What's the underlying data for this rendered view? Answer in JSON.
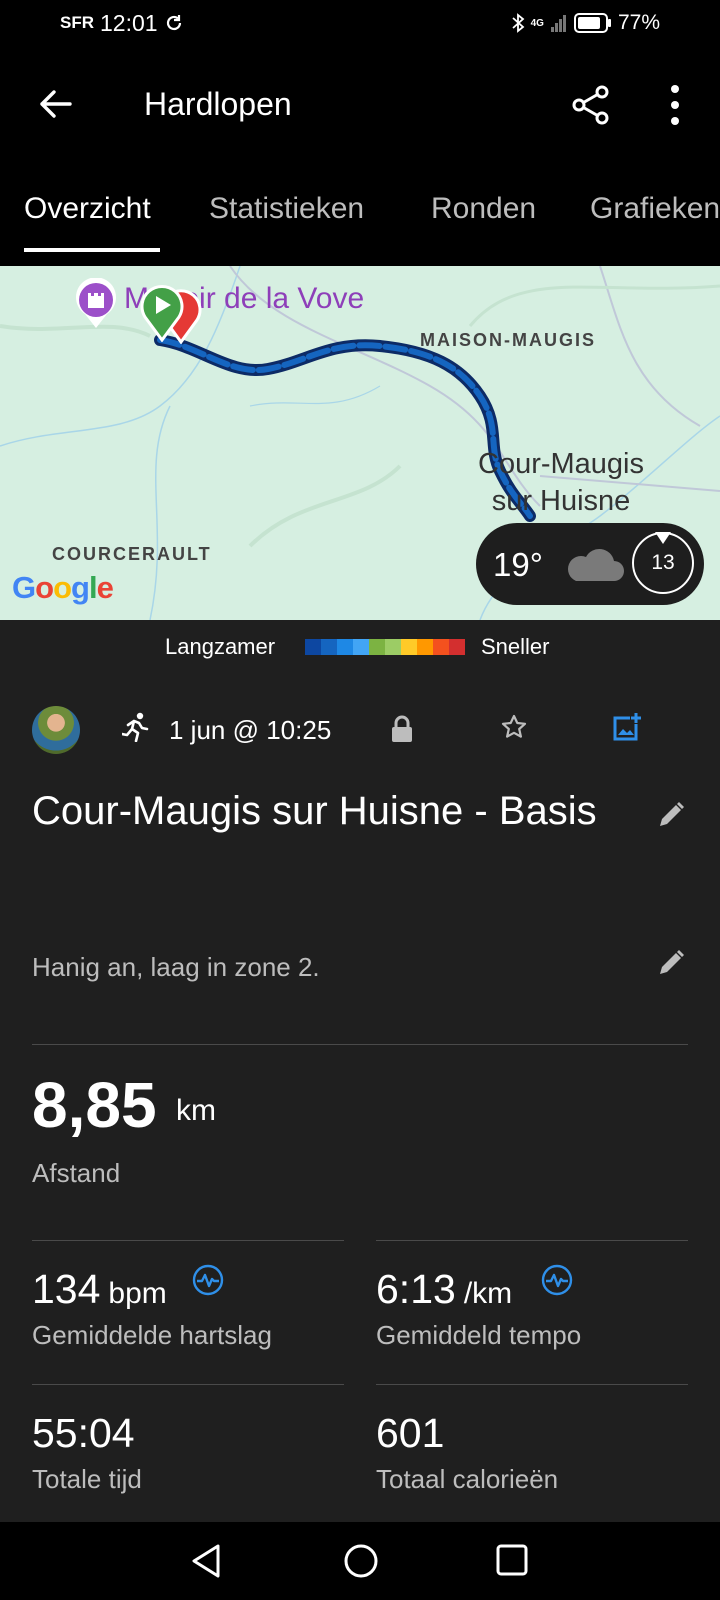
{
  "status_bar": {
    "carrier": "SFR",
    "time": "12:01",
    "network_label": "4G",
    "battery_percent": "77%"
  },
  "app_bar": {
    "title": "Hardlopen",
    "back_icon": "arrow-left-icon",
    "share_icon": "share-icon",
    "more_icon": "more-vertical-icon"
  },
  "tabs": [
    {
      "label": "Overzicht",
      "active": true
    },
    {
      "label": "Statistieken",
      "active": false
    },
    {
      "label": "Ronden",
      "active": false
    },
    {
      "label": "Grafieken",
      "active": false
    }
  ],
  "map": {
    "poi_label": "Manoir de la Vove",
    "place_maison": "MAISON-MAUGIS",
    "town_line1": "Cour-Maugis",
    "town_line2": "sur Huisne",
    "place_courcerault": "COURCERAULT",
    "attribution": "Google",
    "weather": {
      "temperature": "19°",
      "condition_icon": "cloud-icon",
      "wind_speed": "13"
    }
  },
  "pace_legend": {
    "slow_label": "Langzamer",
    "fast_label": "Sneller",
    "colors": [
      "#0d47a1",
      "#1565c0",
      "#1e88e5",
      "#42a5f5",
      "#7cb342",
      "#9ccc65",
      "#ffca28",
      "#ff9800",
      "#f4511e",
      "#d32f2f"
    ]
  },
  "activity": {
    "date": "1 jun @ 10:25",
    "title": "Cour-Maugis sur Huisne - Basis",
    "description": "Hanig an, laag in zone 2.",
    "distance": {
      "value": "8,85",
      "unit": "km",
      "label": "Afstand"
    },
    "stats": [
      {
        "value": "134",
        "unit": "bpm",
        "label": "Gemiddelde hartslag",
        "icon": "pulse-icon"
      },
      {
        "value": "6:13",
        "unit": "/km",
        "label": "Gemiddeld tempo",
        "icon": "pulse-icon"
      },
      {
        "value": "55:04",
        "unit": "",
        "label": "Totale tijd"
      },
      {
        "value": "601",
        "unit": "",
        "label": "Totaal calorieën"
      }
    ]
  },
  "colors": {
    "background": "#000000",
    "panel": "#1f1f1f",
    "accent_blue": "#1e88e5",
    "poi_purple": "#8e3fb9",
    "start_green": "#43a047",
    "end_red": "#e53935"
  }
}
